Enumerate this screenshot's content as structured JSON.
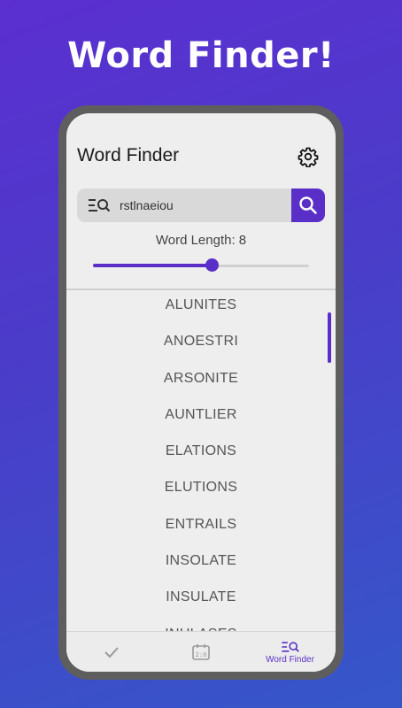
{
  "promo": {
    "headline": "Word Finder!"
  },
  "app": {
    "title": "Word Finder"
  },
  "colors": {
    "accent": "#5a2fc8",
    "background_top": "#5b2fd0",
    "background_bottom": "#3557c9"
  },
  "search": {
    "value": "rstlnaeiou",
    "placeholder": ""
  },
  "word_length": {
    "label": "Word Length: 8",
    "value": 8,
    "slider_fraction": 0.55
  },
  "words": [
    "ALUNITES",
    "ANOESTRI",
    "ARSONITE",
    "AUNTLIER",
    "ELATIONS",
    "ELUTIONS",
    "ENTRAILS",
    "INSOLATE",
    "INSULATE",
    "INULASES"
  ],
  "bottom_nav": {
    "items": [
      {
        "icon": "check-icon",
        "label": ""
      },
      {
        "icon": "scoreboard-icon",
        "label": ""
      },
      {
        "icon": "word-search-icon",
        "label": "Word Finder",
        "active": true
      }
    ]
  }
}
